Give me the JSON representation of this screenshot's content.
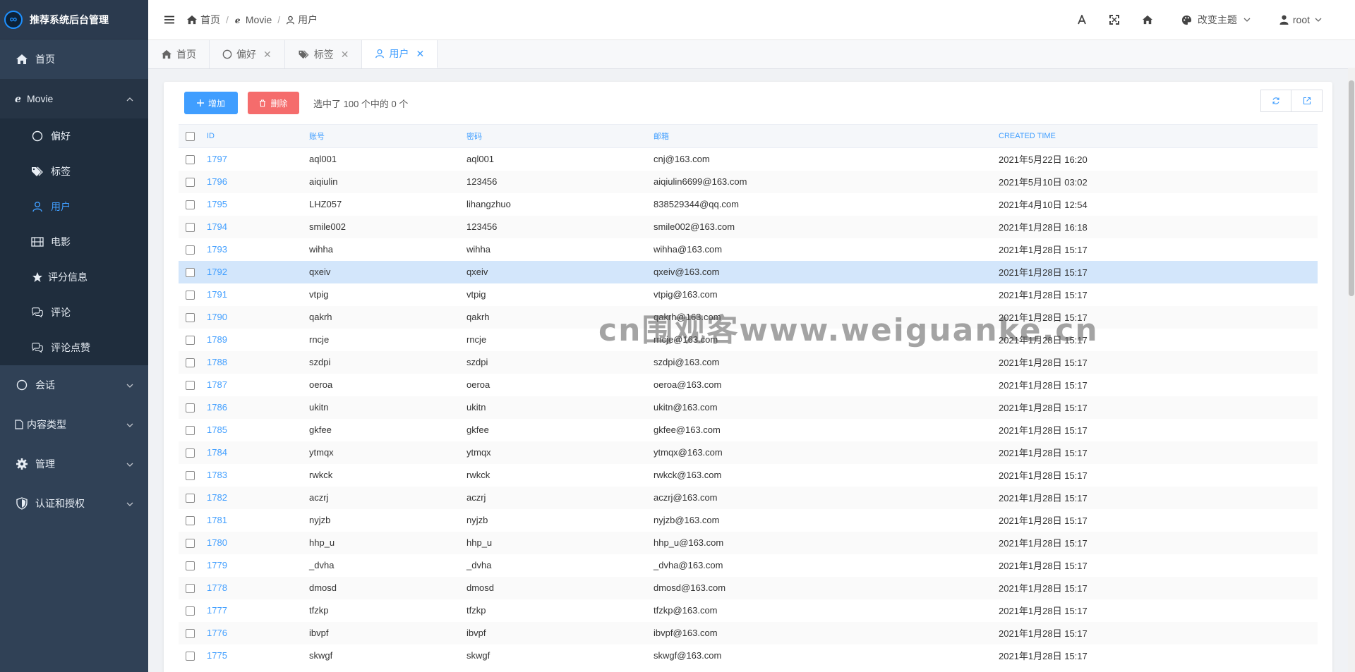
{
  "app": {
    "title": "推荐系统后台管理",
    "logo_glyph": "∞"
  },
  "sidebar": {
    "items": [
      {
        "label": "首页",
        "icon": "home-icon"
      },
      {
        "label": "Movie",
        "icon": "ie-icon",
        "expanded": true
      },
      {
        "label": "会话",
        "icon": "circle-icon"
      },
      {
        "label": "内容类型",
        "icon": "file-icon"
      },
      {
        "label": "管理",
        "icon": "gear-icon"
      },
      {
        "label": "认证和授权",
        "icon": "shield-icon"
      }
    ],
    "sub_items": [
      {
        "label": "偏好",
        "icon": "circle-icon"
      },
      {
        "label": "标签",
        "icon": "tags-icon"
      },
      {
        "label": "用户",
        "icon": "user-icon",
        "active": true
      },
      {
        "label": "电影",
        "icon": "film-icon"
      },
      {
        "label": "评分信息",
        "icon": "star-icon"
      },
      {
        "label": "评论",
        "icon": "comments-icon"
      },
      {
        "label": "评论点赞",
        "icon": "comments-icon"
      }
    ]
  },
  "header": {
    "breadcrumb": [
      "首页",
      "Movie",
      "用户"
    ],
    "theme_label": "改变主题",
    "user_label": "root"
  },
  "tabs": [
    {
      "label": "首页",
      "icon": "home-icon",
      "closable": false
    },
    {
      "label": "偏好",
      "icon": "circle-icon",
      "closable": true
    },
    {
      "label": "标签",
      "icon": "tags-icon",
      "closable": true
    },
    {
      "label": "用户",
      "icon": "user-icon",
      "closable": true,
      "active": true
    }
  ],
  "toolbar": {
    "add_label": "增加",
    "delete_label": "删除",
    "selection_info": "选中了 100 个中的 0 个"
  },
  "table": {
    "columns": [
      "ID",
      "账号",
      "密码",
      "邮箱",
      "CREATED TIME"
    ],
    "rows": [
      [
        "1797",
        "aql001",
        "aql001",
        "cnj@163.com",
        "2021年5月22日 16:20"
      ],
      [
        "1796",
        "aiqiulin",
        "123456",
        "aiqiulin6699@163.com",
        "2021年5月10日 03:02"
      ],
      [
        "1795",
        "LHZ057",
        "lihangzhuo",
        "838529344@qq.com",
        "2021年4月10日 12:54"
      ],
      [
        "1794",
        "smile002",
        "123456",
        "smile002@163.com",
        "2021年1月28日 16:18"
      ],
      [
        "1793",
        "wihha",
        "wihha",
        "wihha@163.com",
        "2021年1月28日 15:17"
      ],
      [
        "1792",
        "qxeiv",
        "qxeiv",
        "qxeiv@163.com",
        "2021年1月28日 15:17"
      ],
      [
        "1791",
        "vtpig",
        "vtpig",
        "vtpig@163.com",
        "2021年1月28日 15:17"
      ],
      [
        "1790",
        "qakrh",
        "qakrh",
        "qakrh@163.com",
        "2021年1月28日 15:17"
      ],
      [
        "1789",
        "rncje",
        "rncje",
        "rncje@163.com",
        "2021年1月28日 15:17"
      ],
      [
        "1788",
        "szdpi",
        "szdpi",
        "szdpi@163.com",
        "2021年1月28日 15:17"
      ],
      [
        "1787",
        "oeroa",
        "oeroa",
        "oeroa@163.com",
        "2021年1月28日 15:17"
      ],
      [
        "1786",
        "ukitn",
        "ukitn",
        "ukitn@163.com",
        "2021年1月28日 15:17"
      ],
      [
        "1785",
        "gkfee",
        "gkfee",
        "gkfee@163.com",
        "2021年1月28日 15:17"
      ],
      [
        "1784",
        "ytmqx",
        "ytmqx",
        "ytmqx@163.com",
        "2021年1月28日 15:17"
      ],
      [
        "1783",
        "rwkck",
        "rwkck",
        "rwkck@163.com",
        "2021年1月28日 15:17"
      ],
      [
        "1782",
        "aczrj",
        "aczrj",
        "aczrj@163.com",
        "2021年1月28日 15:17"
      ],
      [
        "1781",
        "nyjzb",
        "nyjzb",
        "nyjzb@163.com",
        "2021年1月28日 15:17"
      ],
      [
        "1780",
        "hhp_u",
        "hhp_u",
        "hhp_u@163.com",
        "2021年1月28日 15:17"
      ],
      [
        "1779",
        "_dvha",
        "_dvha",
        "_dvha@163.com",
        "2021年1月28日 15:17"
      ],
      [
        "1778",
        "dmosd",
        "dmosd",
        "dmosd@163.com",
        "2021年1月28日 15:17"
      ],
      [
        "1777",
        "tfzkp",
        "tfzkp",
        "tfzkp@163.com",
        "2021年1月28日 15:17"
      ],
      [
        "1776",
        "ibvpf",
        "ibvpf",
        "ibvpf@163.com",
        "2021年1月28日 15:17"
      ],
      [
        "1775",
        "skwgf",
        "skwgf",
        "skwgf@163.com",
        "2021年1月28日 15:17"
      ]
    ],
    "selected_row_id": "1792"
  },
  "watermark": "cn围观客www.weiguanke.cn",
  "colors": {
    "sidebar_bg": "#304156",
    "accent": "#409eff",
    "danger": "#f56c6c"
  }
}
